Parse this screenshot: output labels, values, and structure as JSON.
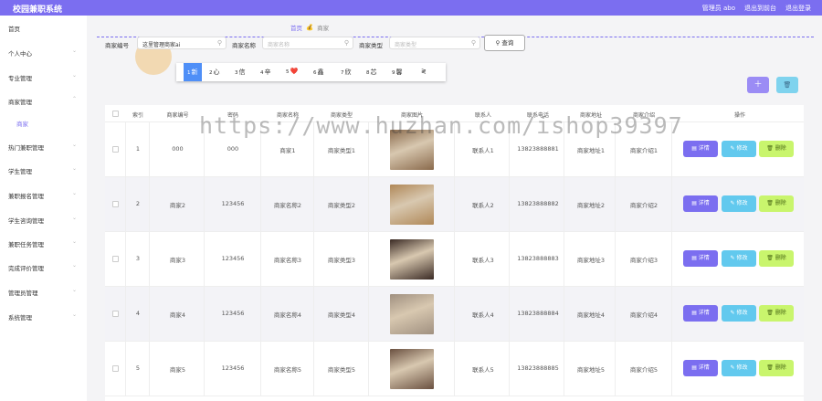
{
  "app": {
    "title": "校园兼职系统"
  },
  "topbar": {
    "user": "管理员 abo",
    "exit_front": "退出到前台",
    "logout": "退出登录"
  },
  "sidebar": {
    "items": [
      {
        "label": "首页",
        "arrow": ""
      },
      {
        "label": "个人中心",
        "arrow": "⌄"
      },
      {
        "label": "专业管理",
        "arrow": "⌄"
      },
      {
        "label": "商家管理",
        "arrow": "⌃"
      },
      {
        "label": "商家",
        "arrow": ""
      },
      {
        "label": "热门兼职管理",
        "arrow": "⌄"
      },
      {
        "label": "学生管理",
        "arrow": "⌄"
      },
      {
        "label": "兼职报名管理",
        "arrow": "⌄"
      },
      {
        "label": "学生咨询管理",
        "arrow": "⌄"
      },
      {
        "label": "兼职任务管理",
        "arrow": "⌄"
      },
      {
        "label": "完成评价管理",
        "arrow": "⌄"
      },
      {
        "label": "管理员管理",
        "arrow": "⌄"
      },
      {
        "label": "系统管理",
        "arrow": "⌄"
      }
    ]
  },
  "breadcrumb": {
    "home": "首页",
    "sep": "💰",
    "current": "商家"
  },
  "search": {
    "f1_label": "商家编号",
    "f1_value": "这里管理商家ai",
    "f2_label": "商家名称",
    "f2_placeholder": "商家名称",
    "f3_label": "商家类型",
    "f3_placeholder": "商家类型",
    "query": "查询"
  },
  "ime": {
    "candidates": [
      {
        "idx": "1",
        "text": "新"
      },
      {
        "idx": "2",
        "text": "心"
      },
      {
        "idx": "3",
        "text": "信"
      },
      {
        "idx": "4",
        "text": "辛"
      },
      {
        "idx": "5",
        "text": "❤️"
      },
      {
        "idx": "6",
        "text": "鑫"
      },
      {
        "idx": "7",
        "text": "欣"
      },
      {
        "idx": "8",
        "text": "芯"
      },
      {
        "idx": "9",
        "text": "馨"
      },
      {
        "idx": "",
        "text": "≷"
      }
    ]
  },
  "actions": {
    "add_icon": "＋",
    "delete_icon": "🗑"
  },
  "table": {
    "columns": [
      "索引",
      "商家编号",
      "密码",
      "商家名称",
      "商家类型",
      "商家图片",
      "联系人",
      "联系电话",
      "商家地址",
      "商家介绍",
      "操作"
    ],
    "rows": [
      {
        "index": "1",
        "code": "000",
        "password": "000",
        "name": "商家1",
        "type": "商家类型1",
        "contact": "联系人1",
        "phone": "13823888881",
        "address": "商家地址1",
        "intro": "商家介绍1"
      },
      {
        "index": "2",
        "code": "商家2",
        "password": "123456",
        "name": "商家名称2",
        "type": "商家类型2",
        "contact": "联系人2",
        "phone": "13823888882",
        "address": "商家地址2",
        "intro": "商家介绍2"
      },
      {
        "index": "3",
        "code": "商家3",
        "password": "123456",
        "name": "商家名称3",
        "type": "商家类型3",
        "contact": "联系人3",
        "phone": "13823888883",
        "address": "商家地址3",
        "intro": "商家介绍3"
      },
      {
        "index": "4",
        "code": "商家4",
        "password": "123456",
        "name": "商家名称4",
        "type": "商家类型4",
        "contact": "联系人4",
        "phone": "13823888884",
        "address": "商家地址4",
        "intro": "商家介绍4"
      },
      {
        "index": "5",
        "code": "商家5",
        "password": "123456",
        "name": "商家名称5",
        "type": "商家类型5",
        "contact": "联系人5",
        "phone": "13823888885",
        "address": "商家地址5",
        "intro": "商家介绍5"
      }
    ],
    "btn_detail": "详情",
    "btn_edit": "修改",
    "btn_delete": "删除"
  },
  "watermark": "https://www.huzhan.com/ishop39397",
  "colors": {
    "accent": "#7b6ef0",
    "edit": "#62c9ee",
    "delete": "#c9f56d"
  }
}
